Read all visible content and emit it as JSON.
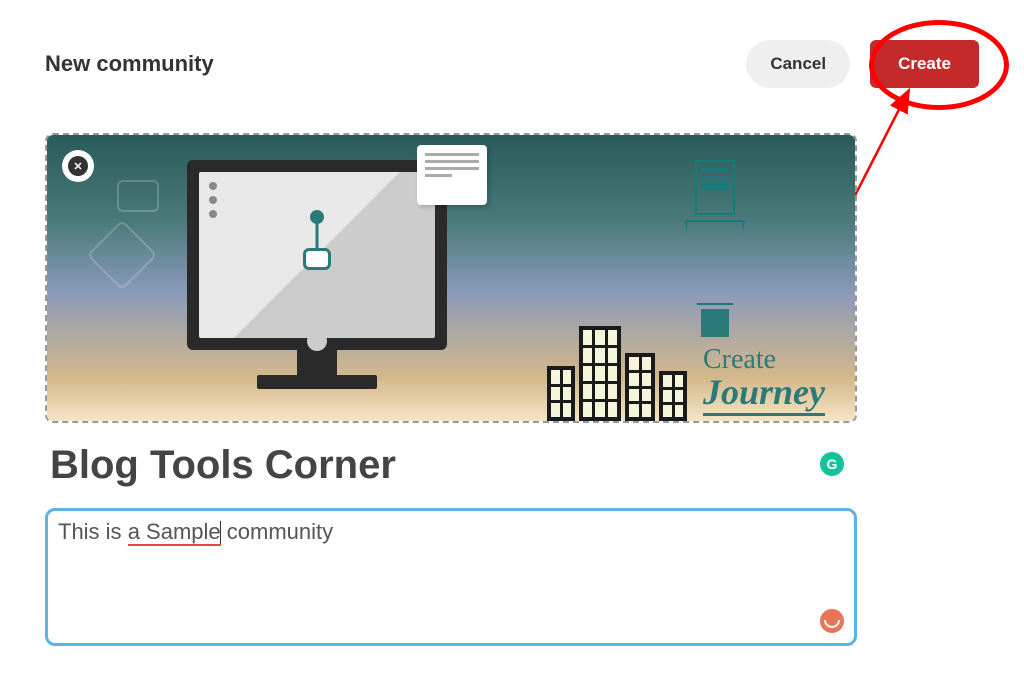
{
  "header": {
    "title": "New community",
    "cancel_label": "Cancel",
    "create_label": "Create"
  },
  "cover": {
    "text_line1": "Create",
    "text_line2": "Journey"
  },
  "form": {
    "community_name": "Blog Tools Corner",
    "description_value": "This is a Sample community",
    "description_part1": "This is ",
    "description_spellcheck": "a Sample",
    "description_part2": " community"
  },
  "icons": {
    "grammarly_glyph": "G"
  },
  "colors": {
    "create_button": "#c42a2a",
    "annotation": "#ff0000",
    "field_border": "#5ab4e8",
    "cover_teal": "#2a7a7a",
    "grammarly": "#15c39a"
  }
}
